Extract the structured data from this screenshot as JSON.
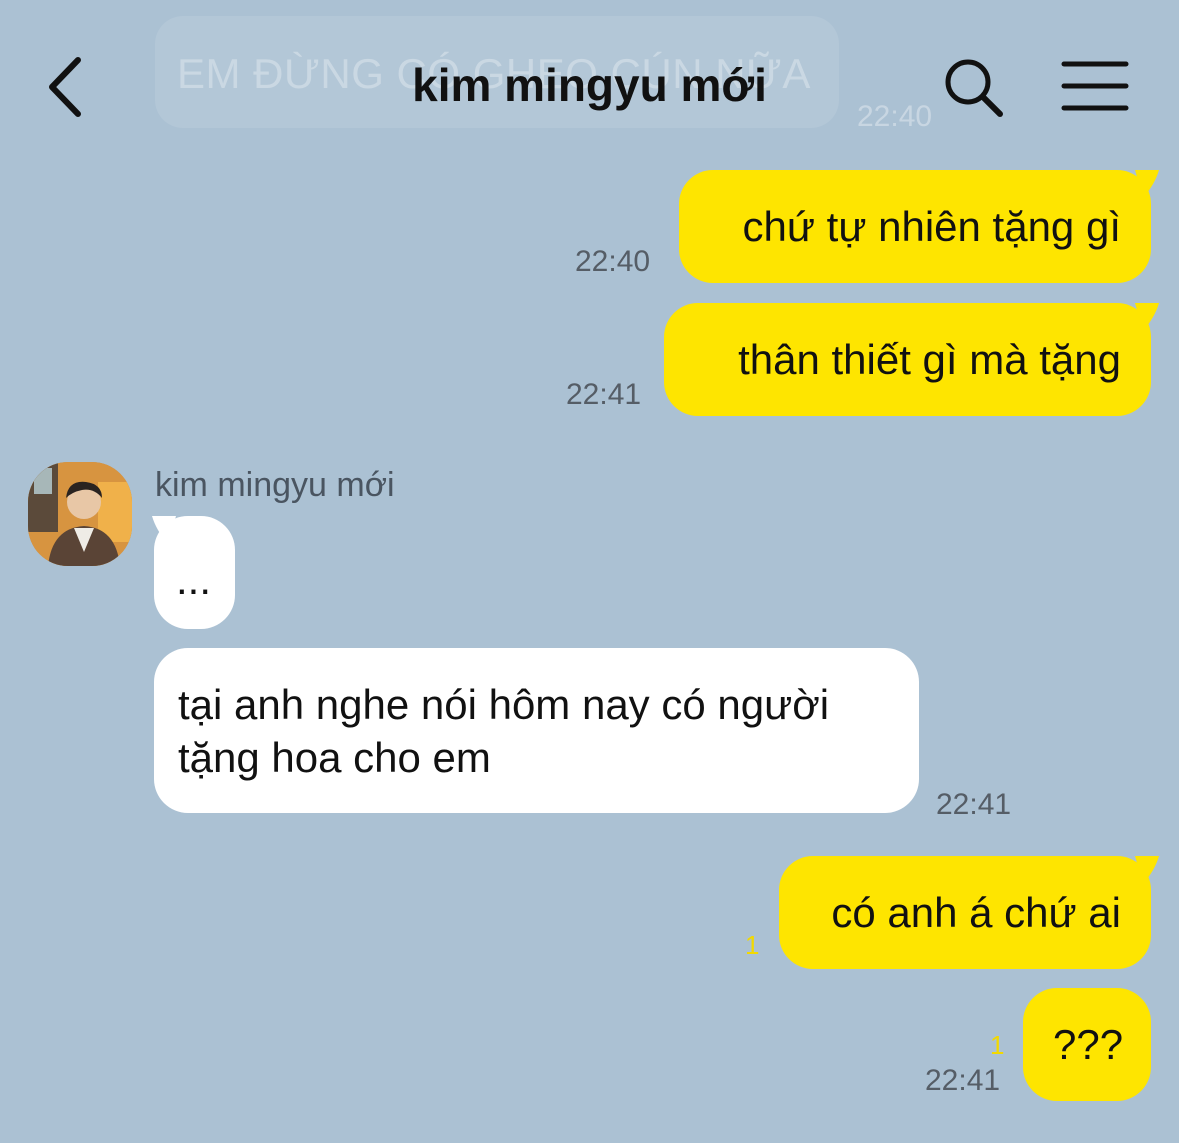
{
  "header": {
    "title": "kim mingyu mới",
    "ghost_message": "EM ĐỪNG CÓ GHẸO CÚN NỮA",
    "ghost_time": "22:40",
    "icons": [
      "back-icon",
      "search-icon",
      "menu-icon"
    ]
  },
  "chat": {
    "partner_name": "kim mingyu mới",
    "messages": [
      {
        "from": "me",
        "text": "chứ tự nhiên tặng gì",
        "time": "22:40"
      },
      {
        "from": "me",
        "text": "thân thiết gì mà tặng",
        "time": "22:41"
      },
      {
        "from": "them",
        "text": "...",
        "time": ""
      },
      {
        "from": "them",
        "text": "tại anh nghe nói hôm nay có người tặng hoa cho em",
        "time": "22:41"
      },
      {
        "from": "me",
        "text": "có anh á chứ ai",
        "time": "",
        "unread": "1"
      },
      {
        "from": "me",
        "text": "???",
        "time": "22:41",
        "unread": "1"
      }
    ]
  },
  "colors": {
    "background": "#abc1d3",
    "my_bubble": "#fee500",
    "their_bubble": "#ffffff",
    "unread_count": "#f2d900"
  }
}
